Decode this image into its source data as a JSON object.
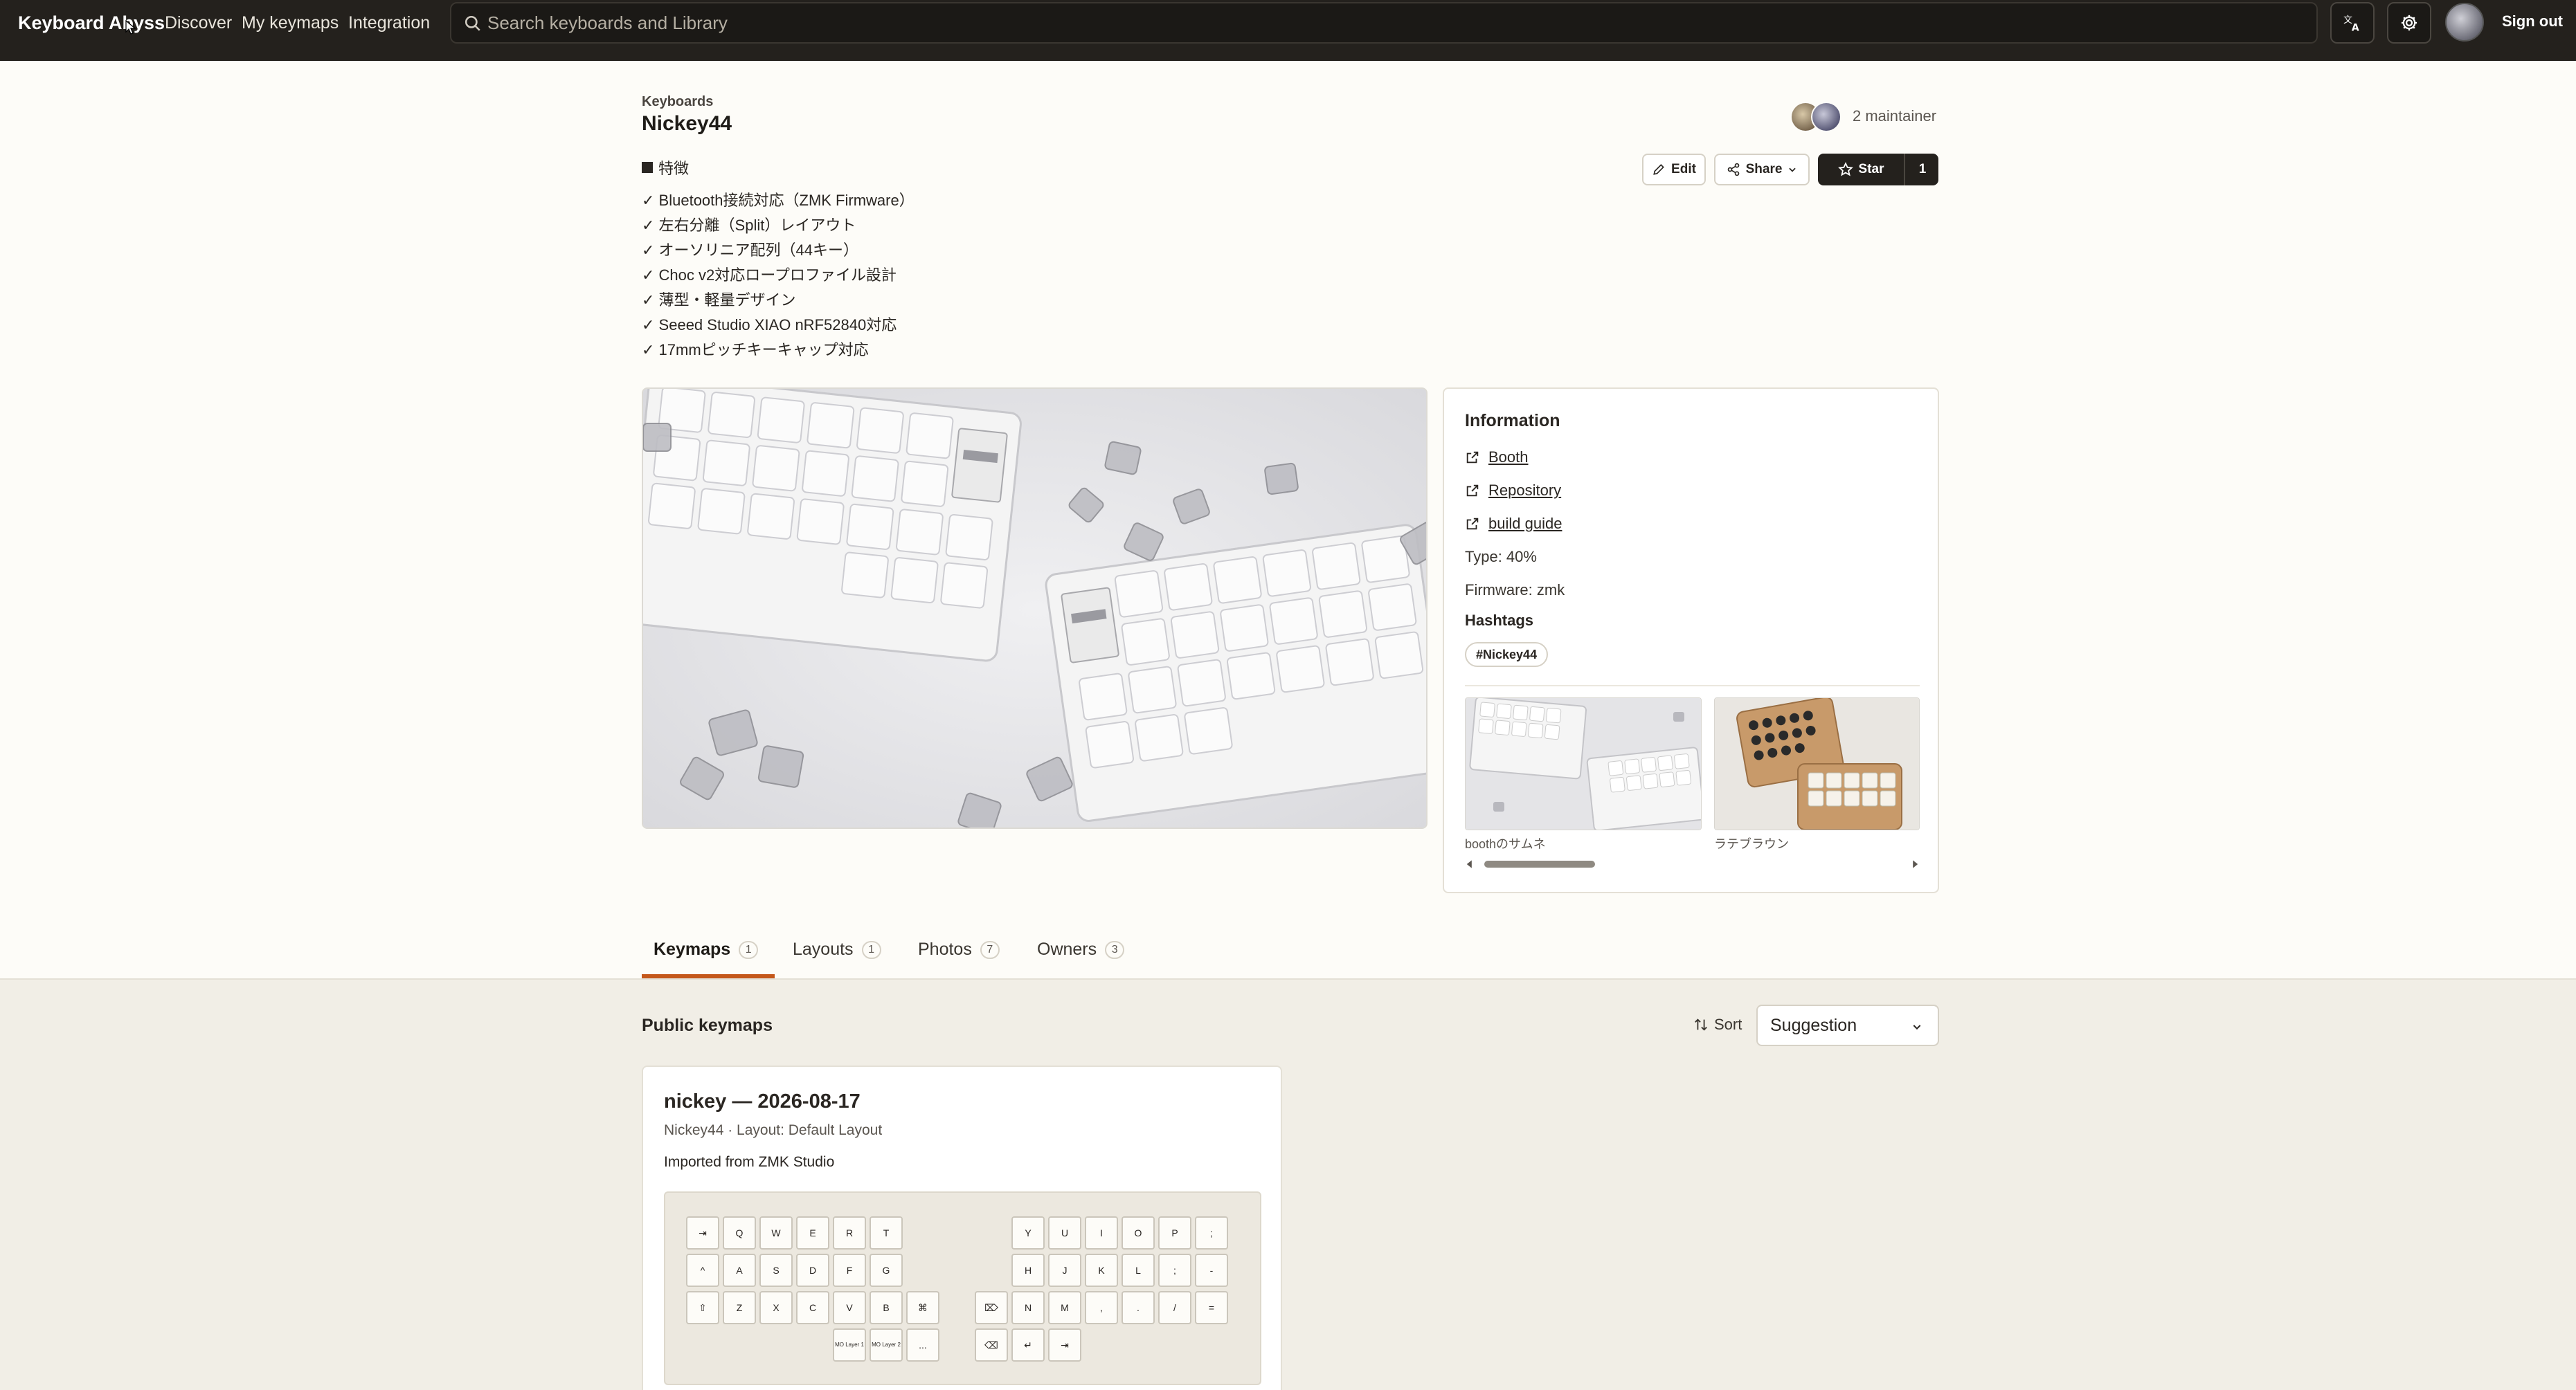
{
  "nav": {
    "brand": "Keyboard Abyss",
    "links": [
      "Discover",
      "My keymaps",
      "Integration"
    ],
    "search_placeholder": "Search keyboards and Library",
    "sign_out": "Sign out"
  },
  "header": {
    "breadcrumb": "Keyboards",
    "title": "Nickey44",
    "maintainers": "2 maintainer",
    "features_heading": "特徴",
    "features": [
      "✓ Bluetooth接続対応（ZMK Firmware）",
      "✓ 左右分離（Split）レイアウト",
      "✓ オーソリニア配列（44キー）",
      "✓ Choc v2対応ロープロファイル設計",
      "✓ 薄型・軽量デザイン",
      "✓ Seeed Studio XIAO nRF52840対応",
      "✓ 17mmピッチキーキャップ対応"
    ],
    "edit_label": "Edit",
    "share_label": "Share",
    "star_label": "Star",
    "star_count": "1"
  },
  "info": {
    "title": "Information",
    "links": [
      "Booth",
      "Repository",
      "build guide"
    ],
    "type": "Type: 40%",
    "firmware": "Firmware: zmk",
    "hashtags_heading": "Hashtags",
    "hashtag": "#Nickey44",
    "thumbnails": [
      "boothのサムネ",
      "ラテブラウン"
    ]
  },
  "tabs": [
    {
      "label": "Keymaps",
      "count": "1"
    },
    {
      "label": "Layouts",
      "count": "1"
    },
    {
      "label": "Photos",
      "count": "7"
    },
    {
      "label": "Owners",
      "count": "3"
    }
  ],
  "keymaps": {
    "section_title": "Public keymaps",
    "sort_label": "Sort",
    "sort_value": "Suggestion",
    "card": {
      "title": "nickey — 2026-08-17",
      "meta": "Nickey44 · Layout: Default Layout",
      "description": "Imported from ZMK Studio",
      "left_keys": [
        [
          "⇥",
          "Q",
          "W",
          "E",
          "R",
          "T"
        ],
        [
          "^",
          "A",
          "S",
          "D",
          "F",
          "G"
        ],
        [
          "⇧",
          "Z",
          "X",
          "C",
          "V",
          "B",
          "⌘"
        ],
        [
          "MO Layer 1",
          "MO Layer 2",
          "..."
        ]
      ],
      "right_keys": [
        [
          "Y",
          "U",
          "I",
          "O",
          "P",
          ";"
        ],
        [
          "H",
          "J",
          "K",
          "L",
          ";",
          "-"
        ],
        [
          "⌦",
          "N",
          "M",
          ",",
          ".",
          "/",
          "="
        ],
        [
          "⌫",
          "↵",
          "⇥"
        ]
      ]
    }
  },
  "colors": {
    "topbar": "#24211d",
    "accent": "#c4571a",
    "page_bg": "#fdfcf8",
    "lower_bg": "#f1eee6"
  }
}
